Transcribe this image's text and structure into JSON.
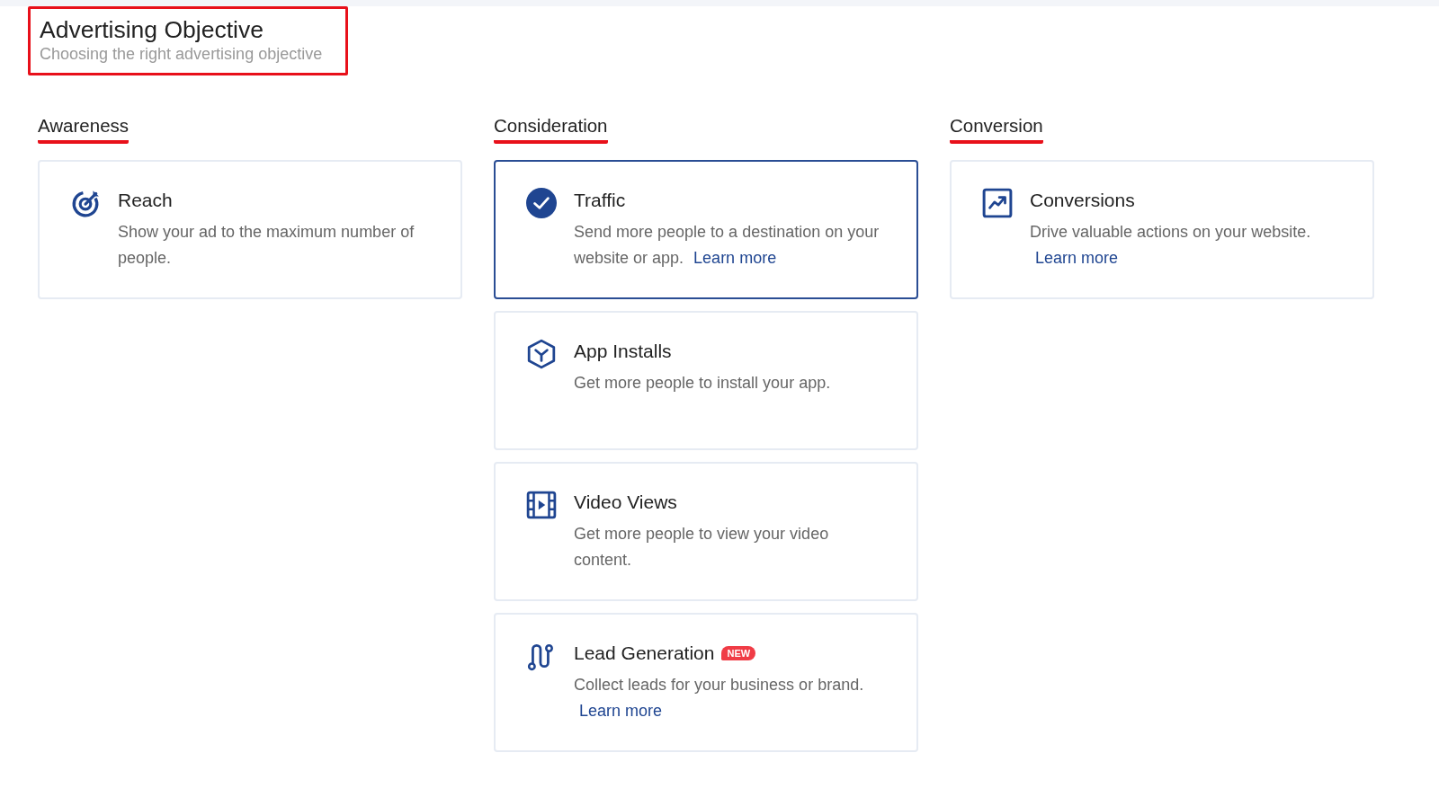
{
  "header": {
    "title": "Advertising Objective",
    "subtitle": "Choosing the right advertising objective"
  },
  "categories": [
    {
      "title": "Awareness",
      "objectives": [
        {
          "kind": "target",
          "title": "Reach",
          "description": "Show your ad to the maximum number of people.",
          "selected": false
        }
      ]
    },
    {
      "title": "Consideration",
      "objectives": [
        {
          "kind": "traffic",
          "title": "Traffic",
          "description": "Send more people to a destination on your website or app.",
          "link": "Learn more",
          "selected": true
        },
        {
          "kind": "app",
          "title": "App Installs",
          "description": "Get more people to install your app.",
          "selected": false
        },
        {
          "kind": "video",
          "title": "Video Views",
          "description": "Get more people to view your video content.",
          "selected": false
        },
        {
          "kind": "lead",
          "title": "Lead Generation",
          "badge": "NEW",
          "description": "Collect leads for your business or brand.",
          "link": "Learn more",
          "selected": false
        }
      ]
    },
    {
      "title": "Conversion",
      "objectives": [
        {
          "kind": "chart",
          "title": "Conversions",
          "description": "Drive valuable actions on your website.",
          "link": "Learn more",
          "selected": false
        }
      ]
    }
  ]
}
